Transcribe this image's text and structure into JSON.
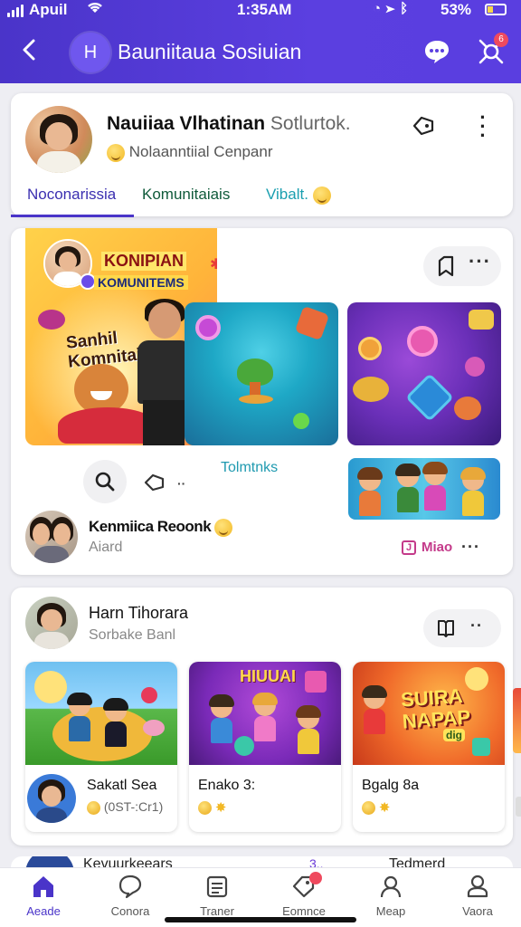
{
  "status_bar": {
    "carrier": "Apuil",
    "time": "1:35AM",
    "battery": "53%"
  },
  "header": {
    "back_label": "‹",
    "avatar_letter": "H",
    "title": "Bauniitaua Sosiuian"
  },
  "profile": {
    "name": "Nauiiaa Vlhatinan",
    "name_suffix": "Sotlurtok.",
    "company": "Nolaanntiial Cenpanr",
    "tabs": [
      {
        "label": "Noconarissia"
      },
      {
        "label": "Komunitaiais"
      },
      {
        "label": "Vibalt."
      }
    ]
  },
  "feed": [
    {
      "banner_title": "KONIPIAN",
      "banner_subtitle": "KOMUNITEMS",
      "banner_caption": "Sanhil\nKomnitain",
      "link_label": "Tolmtnks",
      "author": "Kenmiica Reoonk",
      "author_sub": "Aiard",
      "tag_label": "J",
      "tag_text": "Miao"
    },
    {
      "author": "Harn Tihorara",
      "author_sub": "Sorbake Banl",
      "games": [
        {
          "title": "Sakatl Sea",
          "meta": "(0ST-:Cr1)"
        },
        {
          "title": "Enako 3:",
          "art_title": "HIUUAI"
        },
        {
          "title": "Bgalg 8a",
          "art_title": "SUIRA\nNAPAP",
          "art_sub": "dig"
        }
      ]
    }
  ],
  "peek_row": {
    "name": "Kevuurkeears",
    "mid": "3..",
    "right": "Tedmerd"
  },
  "bottom_nav": [
    {
      "label": "Aeade"
    },
    {
      "label": "Conora"
    },
    {
      "label": "Traner"
    },
    {
      "label": "Eomnce"
    },
    {
      "label": "Meap"
    },
    {
      "label": "Vaora"
    }
  ],
  "colors": {
    "accent": "#4a34c9",
    "header_bg": "#5b3fe0",
    "badge": "#ef4a5e",
    "link": "#1f9ab0"
  }
}
